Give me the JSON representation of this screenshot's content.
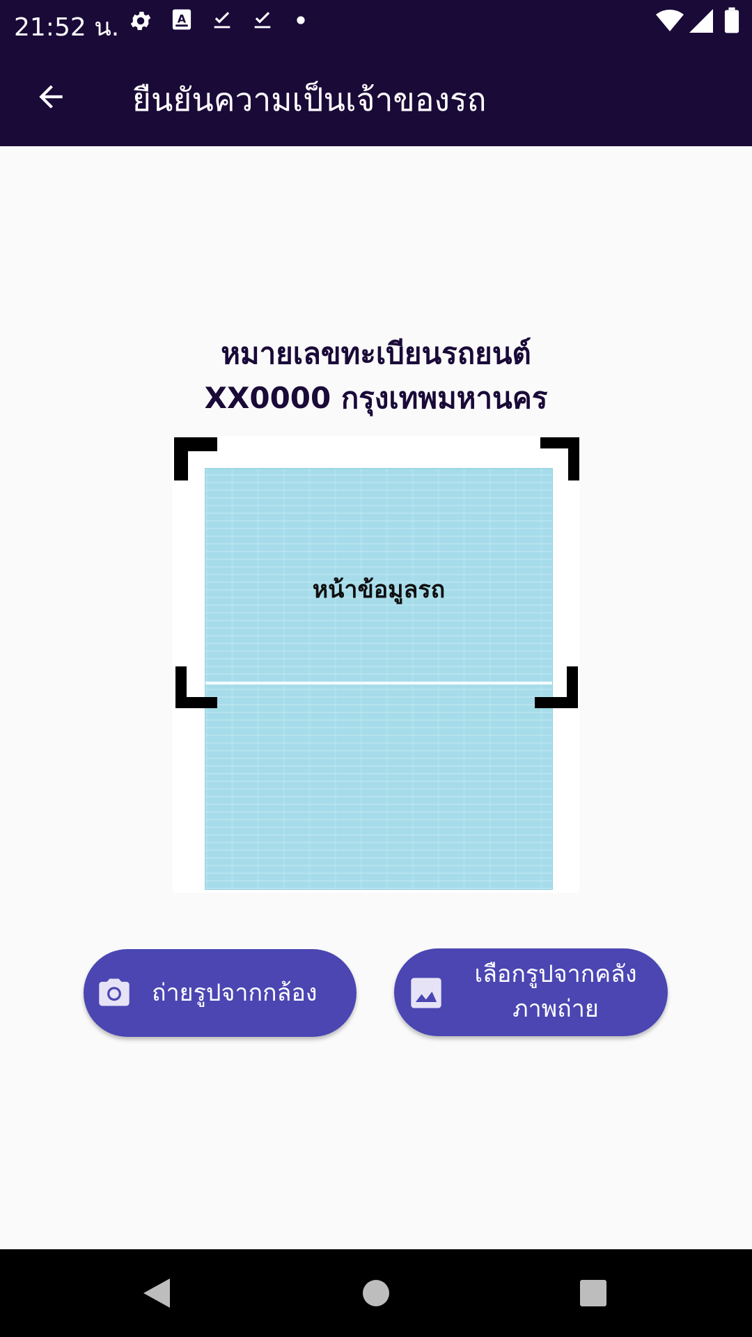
{
  "status_bar": {
    "time": "21:52 น.",
    "left_icons": [
      "gear-icon",
      "keyboard-icon",
      "download-done-icon",
      "download-done-icon",
      "dot-icon"
    ],
    "right_icons": [
      "wifi-icon",
      "signal-icon",
      "battery-icon"
    ]
  },
  "app_bar": {
    "back_icon": "arrow-back-icon",
    "title": "ยืนยันความเป็นเจ้าของรถ"
  },
  "main": {
    "heading_line1": "หมายเลขทะเบียนรถยนต์",
    "heading_line2": "XX0000 กรุงเทพมหานคร",
    "document": {
      "label": "หน้าข้อมูลรถ"
    }
  },
  "buttons": {
    "camera": {
      "icon": "camera-icon",
      "label": "ถ่ายรูปจากกล้อง"
    },
    "gallery": {
      "icon": "image-icon",
      "label": "เลือกรูปจากคลังภาพถ่าย"
    }
  },
  "nav_bar": {
    "icons": [
      "nav-back-icon",
      "nav-home-icon",
      "nav-recents-icon"
    ]
  },
  "colors": {
    "primary_dark": "#1a0a38",
    "button": "#4b46b2",
    "document_blue": "#a6dcea",
    "background": "#fafafa"
  }
}
